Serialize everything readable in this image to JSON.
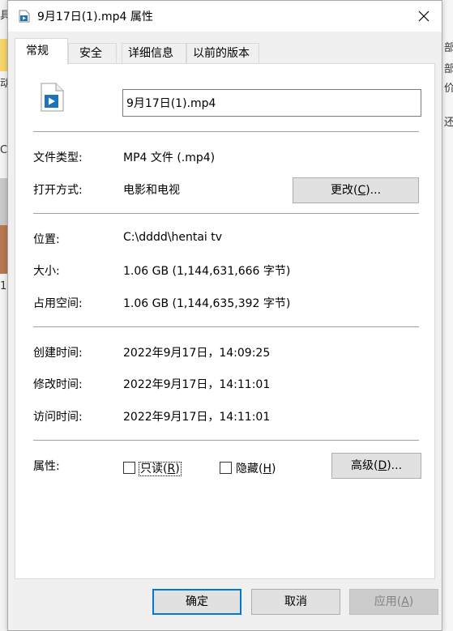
{
  "window": {
    "title": "9月17日(1).mp4 属性"
  },
  "tabs": [
    {
      "label": "常规",
      "active": true
    },
    {
      "label": "安全",
      "active": false
    },
    {
      "label": "详细信息",
      "active": false
    },
    {
      "label": "以前的版本",
      "active": false
    }
  ],
  "general": {
    "filename": "9月17日(1).mp4",
    "file_type_label": "文件类型:",
    "file_type_value": "MP4 文件 (.mp4)",
    "opens_with_label": "打开方式:",
    "opens_with_value": "电影和电视",
    "change_button": {
      "text": "更改(",
      "mnemonic": "C",
      "suffix": ")..."
    },
    "location_label": "位置:",
    "location_value": "C:\\dddd\\hentai tv",
    "size_label": "大小:",
    "size_value": "1.06 GB (1,144,631,666 字节)",
    "size_on_disk_label": "占用空间:",
    "size_on_disk_value": "1.06 GB (1,144,635,392 字节)",
    "created_label": "创建时间:",
    "created_value": "2022年9月17日，14:09:25",
    "modified_label": "修改时间:",
    "modified_value": "2022年9月17日，14:11:01",
    "accessed_label": "访问时间:",
    "accessed_value": "2022年9月17日，14:11:01",
    "attributes_label": "属性:",
    "readonly": {
      "text": "只读(",
      "mnemonic": "R",
      "suffix": ")",
      "checked": false
    },
    "hidden": {
      "text": "隐藏(",
      "mnemonic": "H",
      "suffix": ")",
      "checked": false
    },
    "advanced_button": {
      "text": "高级(",
      "mnemonic": "D",
      "suffix": ")..."
    }
  },
  "footer": {
    "ok": "确定",
    "cancel": "取消",
    "apply": {
      "text": "应用(",
      "mnemonic": "A",
      "suffix": ")"
    }
  },
  "background": {
    "left_glyphs": [
      "具",
      "动",
      "C",
      "1"
    ],
    "right_glyphs": [
      "部",
      "部",
      "价",
      "还"
    ]
  },
  "colors": {
    "accent": "#0078d7",
    "dialog_bg": "#f0f0f0",
    "panel_bg": "#ffffff",
    "button_bg": "#e1e1e1"
  },
  "icons": {
    "title": "video-file-icon",
    "file": "video-file-icon",
    "close": "close-icon"
  }
}
